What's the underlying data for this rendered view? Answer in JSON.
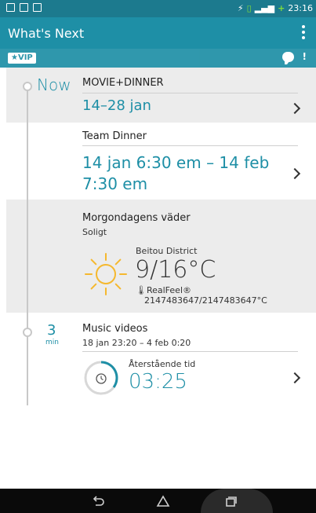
{
  "statusbar": {
    "time": "23:16",
    "battery_indicator": "+"
  },
  "appbar": {
    "title": "What's Next",
    "menu_icon": "overflow-menu-icon"
  },
  "subbar": {
    "vip_label": "★VIP",
    "notification": "!"
  },
  "timeline": {
    "now_label": "Now",
    "event1": {
      "title": "MOVIE+DINNER",
      "time": "14–28 jan"
    },
    "event2": {
      "title": "Team Dinner",
      "time_line1": "14 jan 6:30 em – 14 feb",
      "time_line2": "7:30 em"
    },
    "weather": {
      "title": "Morgondagens väder",
      "condition": "Soligt",
      "location": "Beitou District",
      "temp": "9/16°C",
      "realfeel_label": "RealFeel®",
      "realfeel_value": "2147483647/2147483647°C"
    },
    "event3": {
      "minutes": "3",
      "minutes_unit": "min",
      "title": "Music videos",
      "time": "18 jan 23:20 – 4 feb 0:20",
      "remaining_label": "Återstående tid",
      "remaining_value": "03:25"
    }
  },
  "colors": {
    "accent": "#1e8fa6",
    "card_gray": "#ececec",
    "sun": "#f5b82e"
  }
}
